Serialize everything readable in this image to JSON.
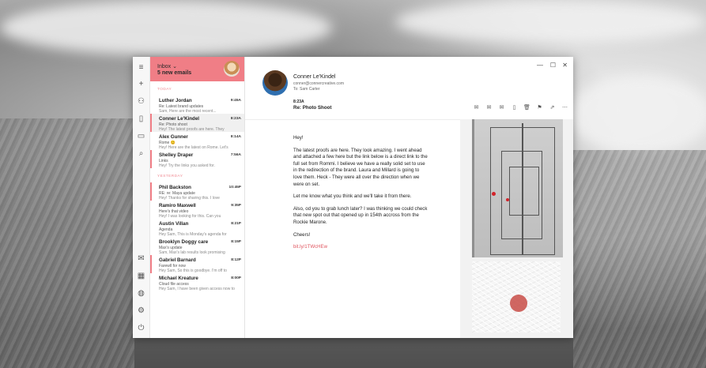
{
  "inbox": {
    "title": "Inbox",
    "title_caret": "⌄",
    "new_count_label": "5 new emails"
  },
  "sections": {
    "today": "TODAY",
    "yesterday": "YESTERDAY"
  },
  "emails": [
    {
      "name": "Luther Jordan",
      "time": "9:45A",
      "subject": "Re: Latest brand updates",
      "preview": "Sam, Here are the most recent...",
      "flag": false,
      "selected": false
    },
    {
      "name": "Conner Le'Kindel",
      "time": "8:23A",
      "subject": "Re: Photo shoot",
      "preview": "Hey! The latest proofs are here. They",
      "flag": true,
      "selected": true
    },
    {
      "name": "Alex Gunner",
      "time": "8:14A",
      "subject": "Rome 😊",
      "preview": "Hey! Here are the latest on Rome. Let's",
      "flag": false,
      "selected": false
    },
    {
      "name": "Shelley Draper",
      "time": "7:56A",
      "subject": "Links",
      "preview": "Hey! Try the links you asked for.",
      "flag": true,
      "selected": false
    },
    {
      "name": "Phil Backston",
      "time": "10:45P",
      "subject": "RE: re: Maya update",
      "preview": "Hey! Thanks for sharing this. I love",
      "flag": true,
      "selected": false
    },
    {
      "name": "Ramiro Maxwell",
      "time": "9:35P",
      "subject": "Here's that video",
      "preview": "Hey! I was looking for this. Can you",
      "flag": false,
      "selected": false
    },
    {
      "name": "Austin Villan",
      "time": "8:21P",
      "subject": "Agenda",
      "preview": "Hey Sam, This is Monday's agenda for",
      "flag": false,
      "selected": false
    },
    {
      "name": "Brooklyn Doggy care",
      "time": "8:15P",
      "subject": "Max's update",
      "preview": "Sam, Max's lab results look promising",
      "flag": false,
      "selected": false
    },
    {
      "name": "Gabriel Barnard",
      "time": "8:12P",
      "subject": "Farewll for now",
      "preview": "Hey Sam, So this is goodbye. I'm off to",
      "flag": true,
      "selected": false
    },
    {
      "name": "Michael Kreature",
      "time": "8:00P",
      "subject": "Cloud file access",
      "preview": "Hey Sam, I have been given access now to",
      "flag": false,
      "selected": false
    }
  ],
  "message": {
    "from_name": "Conner Le'Kindel",
    "from_email": "conner@connercreative.com",
    "to_line": "To: Sam Carter",
    "time": "8:23A",
    "subject": "Re: Photo Shoot",
    "greeting": "Hey!",
    "para1": "The latest proofs are here. They look amazing. I went ahead and attached a few here but the link below is a direct link to the full set from Rommi. I believe we have a really solid set to use in the redirection of the brand. Laura and Millard is going to love them. Heck - They were all over the direction when we were on set.",
    "para2": "Let me know what you think and we'll take it from there.",
    "para3": "Also, od you to grab lunch later? I was thinking we could check that new spot out that opened up in 154th accross from the Rockie Marone.",
    "signoff": "Cheers!",
    "link": "bit.ly/1TWcHEw"
  },
  "icons": {
    "rail": [
      "menu-icon",
      "compose-icon",
      "contacts-icon",
      "phone-icon",
      "tablet-icon",
      "search-icon",
      "mail-icon",
      "calendar-icon",
      "globe-icon",
      "settings-icon",
      "power-icon"
    ],
    "toolbar": [
      "reply-icon",
      "reply-all-icon",
      "forward-icon",
      "document-icon",
      "trash-icon",
      "flag-icon",
      "move-icon",
      "more-icon"
    ]
  },
  "colors": {
    "accent": "#f07e86",
    "link": "#e0555f"
  }
}
